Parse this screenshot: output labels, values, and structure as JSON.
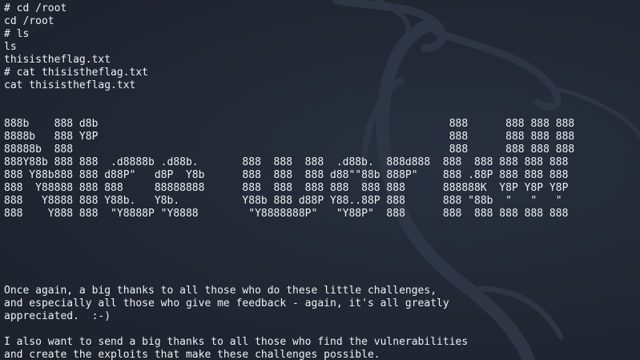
{
  "terminal": {
    "lines": [
      "# cd /root",
      "cd /root",
      "# ls",
      "ls",
      "thisistheflag.txt",
      "# cat thisistheflag.txt",
      "cat thisistheflag.txt",
      "",
      "",
      "888b    888 d8b                                                        888      888 888 888",
      "8888b   888 Y8P                                                        888      888 888 888",
      "88888b  888                                                            888      888 888 888",
      "888Y88b 888 888  .d8888b .d88b.       888  888  888  .d88b.  888d888  888  888 888 888 888",
      "888 Y88b888 888 d88P\"   d8P  Y8b      888  888  888 d88\"\"88b 888P\"    888 .88P 888 888 888",
      "888  Y88888 888 888     88888888      888  888  888 888  888 888      888888K  Y8P Y8P Y8P",
      "888   Y8888 888 Y88b.   Y8b.          Y88b 888 d88P Y88..88P 888      888 \"88b  \"   \"   \"",
      "888    Y888 888  \"Y8888P \"Y8888        \"Y8888888P\"   \"Y88P\"  888      888  888 888 888 888",
      "",
      "",
      "",
      "",
      "",
      "Once again, a big thanks to all those who do these little challenges,",
      "and especially all those who give me feedback - again, it's all greatly",
      "appreciated.  :-)",
      "",
      "I also want to send a big thanks to all those who find the vulnerabilities",
      "and create the exploits that make these challenges possible."
    ]
  },
  "colors": {
    "background": "#1f2430",
    "text": "#eef0f4",
    "watermark": "#2e3646"
  },
  "icons": {
    "watermark": "kali-dragon-icon"
  }
}
